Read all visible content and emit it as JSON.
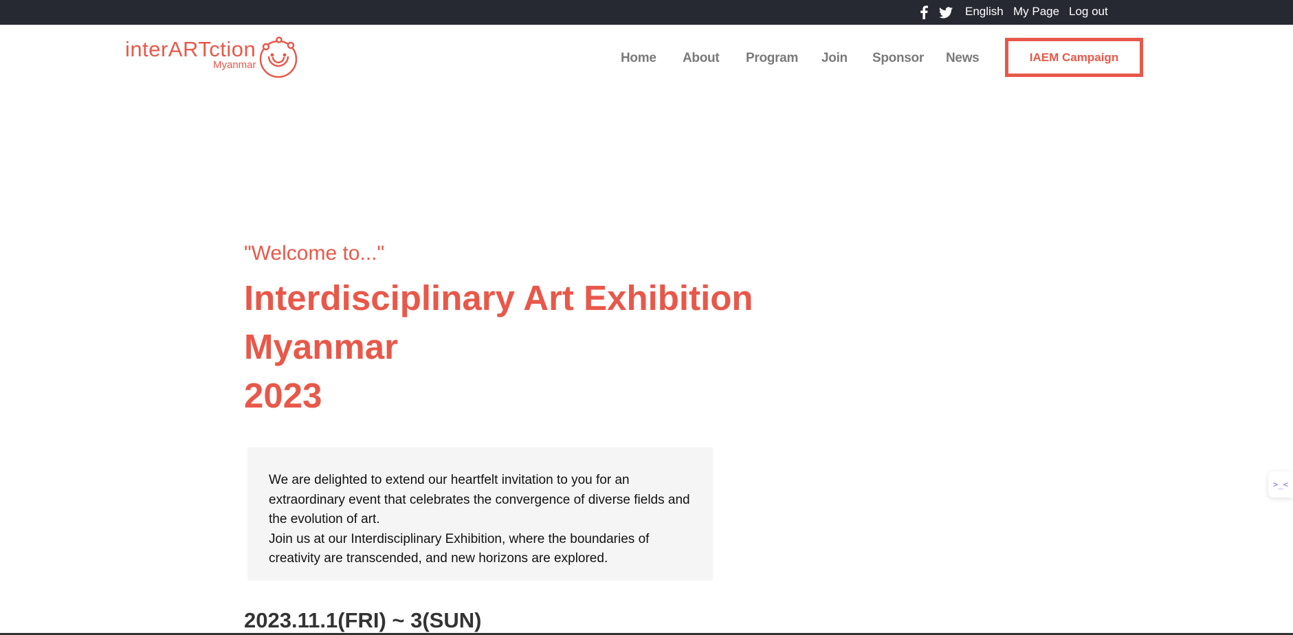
{
  "topbar": {
    "facebook_icon": "facebook-icon",
    "twitter_icon": "twitter-icon",
    "language": "English",
    "my_page": "My Page",
    "log_out": "Log out"
  },
  "header": {
    "logo_word": "interARTction",
    "logo_sub": "Myanmar",
    "nav": [
      "Home",
      "About",
      "Program",
      "Join",
      "Sponsor",
      "News"
    ],
    "campaign_button": "IAEM Campaign"
  },
  "hero": {
    "welcome": "\"Welcome to...\"",
    "title_lines": [
      "Interdisciplinary Art Exhibition",
      "Myanmar",
      "2023"
    ],
    "intro_paragraphs": [
      "We are delighted to extend our heartfelt invitation to you for an extraordinary event that celebrates the convergence of diverse fields and the evolution of art.",
      "Join us at our Interdisciplinary Exhibition, where the boundaries of creativity are transcended, and new horizons are explored."
    ],
    "dates": "2023.11.1(FRI) ~ 3(SUN)"
  },
  "side_widget": {
    "glyph": ">_<"
  },
  "colors": {
    "brand": "#e8584a",
    "topbar_bg": "#262932",
    "nav_text": "#7a7a7a",
    "intro_bg": "#f5f5f5"
  }
}
